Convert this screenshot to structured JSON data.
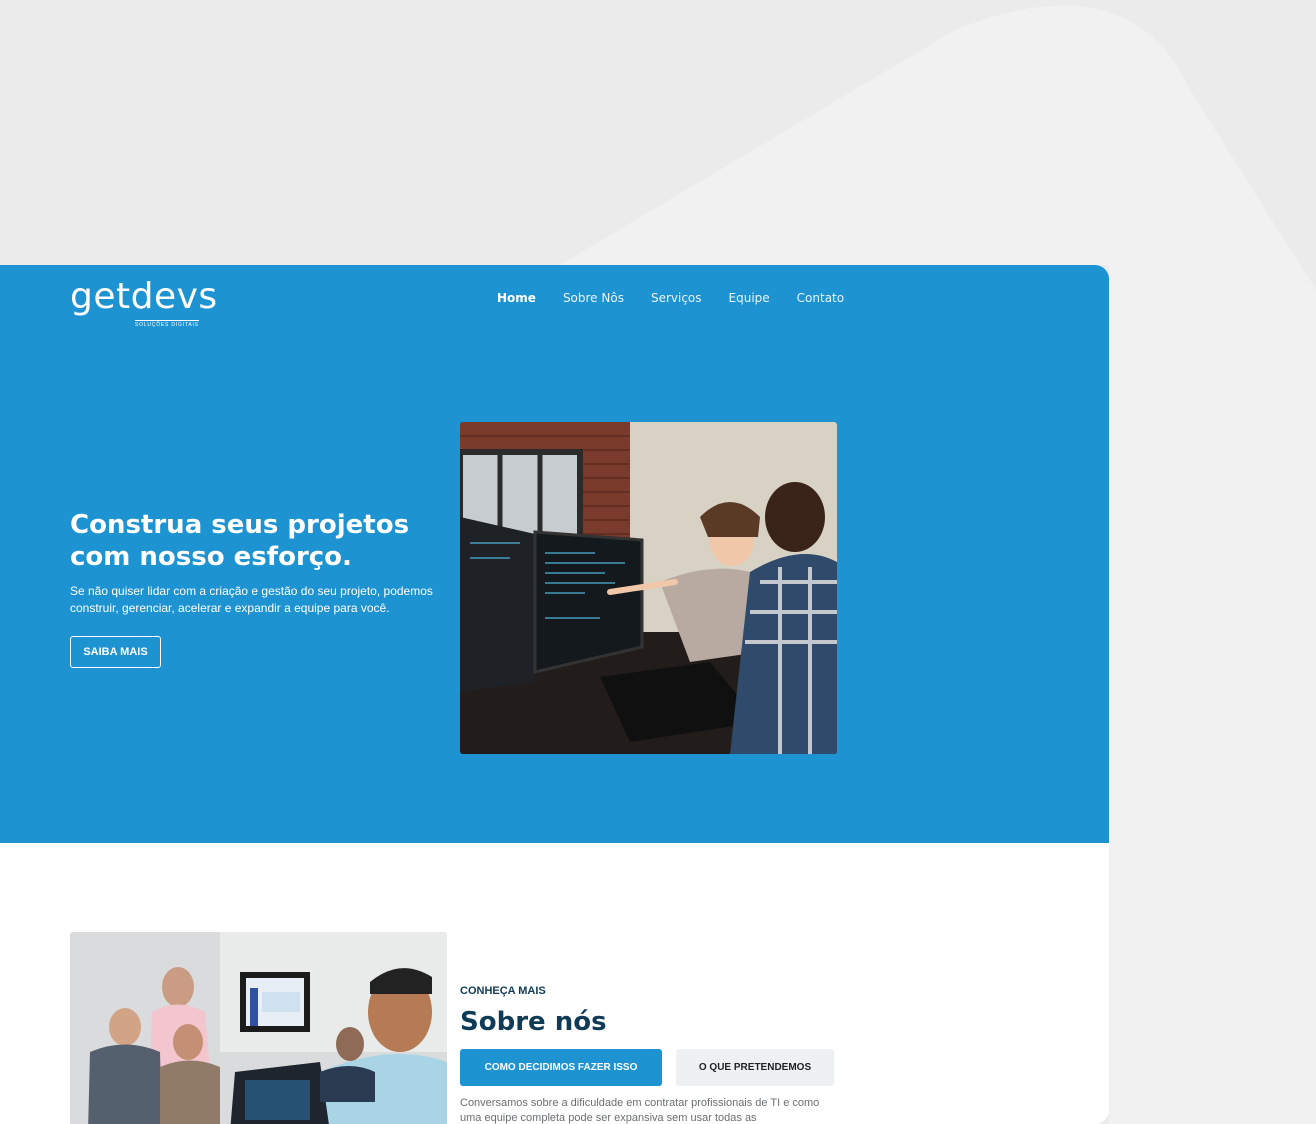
{
  "brand": {
    "name": "getdevs",
    "tagline": "SOLUÇÕES DIGITAIS"
  },
  "nav": {
    "items": [
      {
        "label": "Home",
        "active": true
      },
      {
        "label": "Sobre Nôs",
        "active": false
      },
      {
        "label": "Serviços",
        "active": false
      },
      {
        "label": "Equipe",
        "active": false
      },
      {
        "label": "Contato",
        "active": false
      }
    ]
  },
  "hero": {
    "title": "Construa seus projetos com nosso esforço.",
    "text": "Se não quiser lidar com a criação e gestão do seu projeto, podemos construir, gerenciar, acelerar e expandir a equipe para você.",
    "button_label": "SAIBA MAIS",
    "image": "developers-at-monitor-photo"
  },
  "about": {
    "eyebrow": "CONHEÇA MAIS",
    "title": "Sobre nós",
    "tabs": [
      {
        "label": "COMO DECIDIMOS FAZER ISSO",
        "active": true
      },
      {
        "label": "O QUE PRETENDEMOS",
        "active": false
      }
    ],
    "text": "Conversamos sobre a dificuldade em contratar profissionais de TI e como uma equipe completa pode ser expansiva sem usar todas as",
    "image": "team-meeting-photo"
  },
  "colors": {
    "primary": "#1e93d2",
    "heading": "#0f3b57",
    "background": "#ebebeb"
  }
}
